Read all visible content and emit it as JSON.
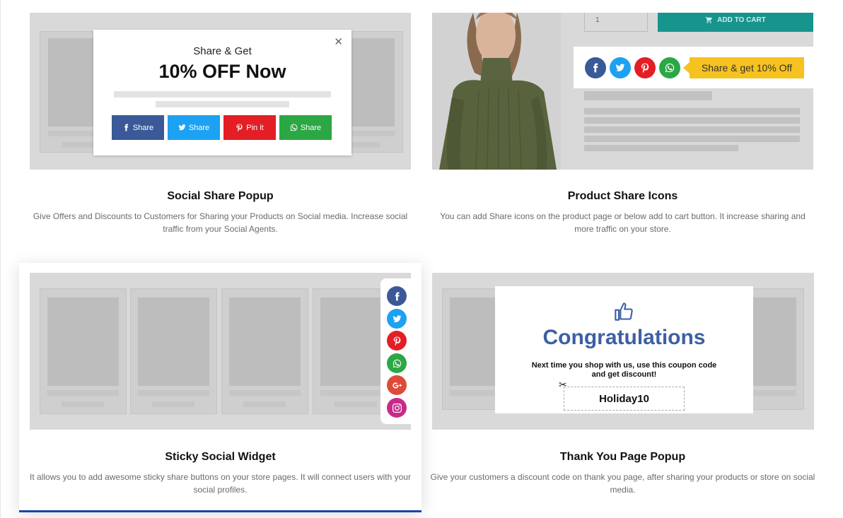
{
  "cards": [
    {
      "title": "Social Share Popup",
      "description": "Give Offers and Discounts to Customers for Sharing your Products on Social media. Increase social traffic from your Social Agents.",
      "popup": {
        "subtitle": "Share & Get",
        "headline": "10% OFF Now",
        "close_icon": "close-icon",
        "buttons": [
          {
            "label": "Share",
            "icon": "facebook-icon",
            "color": "#3b5998"
          },
          {
            "label": "Share",
            "icon": "twitter-icon",
            "color": "#1da1f2"
          },
          {
            "label": "Pin it",
            "icon": "pinterest-icon",
            "color": "#e31e25"
          },
          {
            "label": "Share",
            "icon": "whatsapp-icon",
            "color": "#2ca745"
          }
        ]
      }
    },
    {
      "title": "Product Share Icons",
      "description": "You can add Share icons on the product page or below add to cart button. It increase sharing and more traffic on your store.",
      "quantity": "1",
      "add_to_cart": "ADD TO CART",
      "share_tag": "Share & get 10% Off",
      "icons": [
        {
          "icon": "facebook-icon",
          "color": "#3b5998"
        },
        {
          "icon": "twitter-icon",
          "color": "#1da1f2"
        },
        {
          "icon": "pinterest-icon",
          "color": "#e31e25"
        },
        {
          "icon": "whatsapp-icon",
          "color": "#2ca745"
        }
      ]
    },
    {
      "title": "Sticky Social Widget",
      "description": "It allows you to add awesome sticky share buttons on your store pages. It will connect users with your social profiles.",
      "icons": [
        {
          "icon": "facebook-icon",
          "color": "#3b5998"
        },
        {
          "icon": "twitter-icon",
          "color": "#1da1f2"
        },
        {
          "icon": "pinterest-icon",
          "color": "#e31e25"
        },
        {
          "icon": "whatsapp-icon",
          "color": "#2ca745"
        },
        {
          "icon": "google-plus-icon",
          "color": "#dd4b39"
        },
        {
          "icon": "instagram-icon",
          "color": "#c72a8b"
        }
      ]
    },
    {
      "title": "Thank You Page Popup",
      "description": "Give your customers a discount code on thank you page, after sharing your products or store on social media.",
      "popup": {
        "headline": "Congratulations",
        "message": "Next time you shop with us, use this coupon code and get discount!",
        "coupon": "Holiday10",
        "thumb_icon": "thumbs-up-icon",
        "scissors_icon": "scissors-icon"
      }
    }
  ],
  "colors": {
    "accent_bar": "#1a45a8",
    "preview_bg": "#d9d9d9",
    "tag": "#f6c21f",
    "add_to_cart": "#17948c",
    "congrats": "#3d5fa4"
  }
}
